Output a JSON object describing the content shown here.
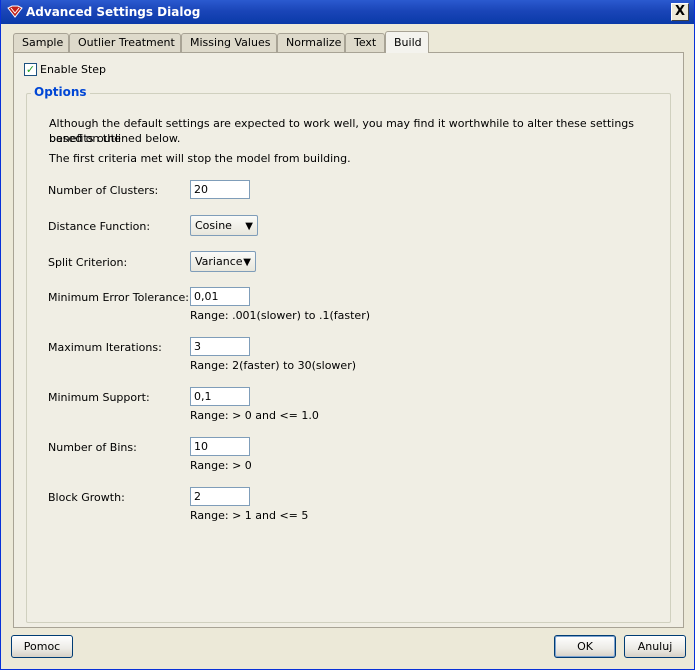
{
  "window": {
    "title": "Advanced Settings Dialog",
    "close_label": "X"
  },
  "tabs": [
    {
      "label": "Sample"
    },
    {
      "label": "Outlier Treatment"
    },
    {
      "label": "Missing Values"
    },
    {
      "label": "Normalize"
    },
    {
      "label": "Text"
    },
    {
      "label": "Build",
      "active": true
    }
  ],
  "enable_step": {
    "label": "Enable Step",
    "checked": true
  },
  "options": {
    "title": "Options",
    "description_1": "Although the default settings are expected to work well, you may find it worthwhile to alter these settings based on the",
    "description_2": "benefits outlined below.",
    "description_3": "The first criteria met will stop the model from building.",
    "fields": {
      "clusters": {
        "label": "Number of Clusters:",
        "value": "20"
      },
      "distance": {
        "label": "Distance Function:",
        "value": "Cosine"
      },
      "split": {
        "label": "Split Criterion:",
        "value": "Variance"
      },
      "error_tol": {
        "label": "Minimum Error Tolerance:",
        "value": "0,01",
        "range": "Range: .001(slower) to .1(faster)"
      },
      "max_iter": {
        "label": "Maximum Iterations:",
        "value": "3",
        "range": "Range: 2(faster) to 30(slower)"
      },
      "min_support": {
        "label": "Minimum Support:",
        "value": "0,1",
        "range": "Range: > 0 and <= 1.0"
      },
      "bins": {
        "label": "Number of Bins:",
        "value": "10",
        "range": "Range: > 0"
      },
      "block_growth": {
        "label": "Block Growth:",
        "value": "2",
        "range": "Range: > 1 and <= 5"
      }
    }
  },
  "buttons": {
    "help": "Pomoc",
    "ok": "OK",
    "cancel": "Anuluj"
  },
  "colors": {
    "titlebar": "#0A3AA8",
    "accent_text": "#0046D5",
    "dialog_bg": "#ECE9D8"
  }
}
